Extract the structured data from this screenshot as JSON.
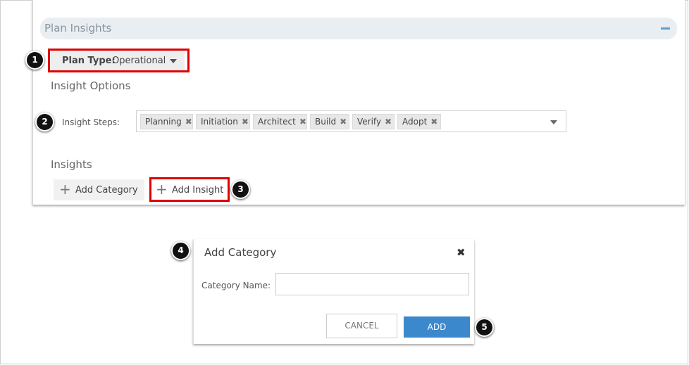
{
  "panel": {
    "title": "Plan Insights",
    "collapse_icon": "minus-icon"
  },
  "plan_type": {
    "label": "Plan Type:",
    "value": "Operational"
  },
  "insight_options": {
    "heading": "Insight Options",
    "steps_label": "Insight Steps:",
    "steps": [
      "Planning",
      "Initiation",
      "Architect",
      "Build",
      "Verify",
      "Adopt"
    ],
    "remove_glyph": "✖"
  },
  "insights": {
    "heading": "Insights",
    "add_category_label": "Add Category",
    "add_insight_label": "Add Insight",
    "plus_glyph": "+"
  },
  "dialog": {
    "title": "Add Category",
    "close_glyph": "✖",
    "field_label": "Category Name:",
    "field_value": "",
    "cancel_label": "CANCEL",
    "add_label": "ADD"
  },
  "callouts": [
    "1",
    "2",
    "3",
    "4",
    "5"
  ],
  "colors": {
    "highlight": "#e00000",
    "primary_button": "#3b88cc",
    "badge": "#111111"
  }
}
